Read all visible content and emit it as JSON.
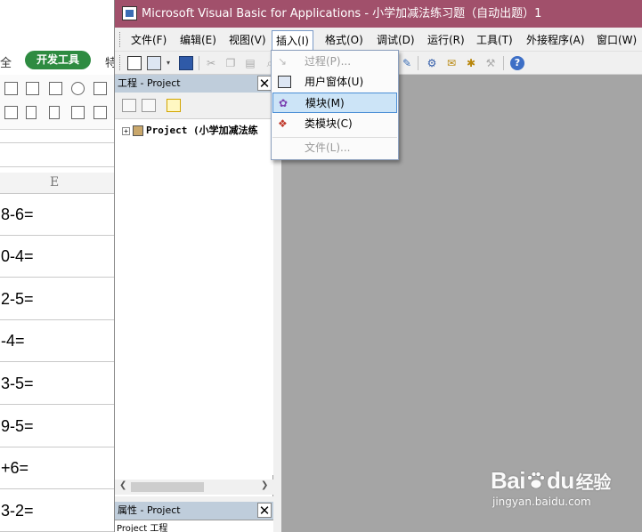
{
  "excel": {
    "ribbon": {
      "quan_label": "全",
      "dev_tools_tab": "开发工具",
      "te_label": "特"
    },
    "column_header": "E",
    "rows": [
      "8-6=",
      "0-4=",
      "2-5=",
      "-4=",
      "3-5=",
      "9-5=",
      "+6=",
      "3-2="
    ]
  },
  "vbe": {
    "title": "Microsoft Visual Basic for Applications - 小学加减法练习题（自动出题）1",
    "menu": [
      {
        "label": "文件(F)"
      },
      {
        "label": "编辑(E)"
      },
      {
        "label": "视图(V)"
      },
      {
        "label": "插入(I)",
        "open": true
      },
      {
        "label": "格式(O)"
      },
      {
        "label": "调试(D)"
      },
      {
        "label": "运行(R)"
      },
      {
        "label": "工具(T)"
      },
      {
        "label": "外接程序(A)"
      },
      {
        "label": "窗口(W)"
      }
    ],
    "insert_menu": {
      "items": [
        {
          "label": "过程(P)...",
          "enabled": false,
          "icon": "procedure-icon"
        },
        {
          "label": "用户窗体(U)",
          "enabled": true,
          "icon": "userform-icon"
        },
        {
          "label": "模块(M)",
          "enabled": true,
          "highlighted": true,
          "icon": "module-icon"
        },
        {
          "label": "类模块(C)",
          "enabled": true,
          "icon": "class-module-icon"
        },
        {
          "label": "文件(L)...",
          "enabled": false,
          "icon": ""
        }
      ]
    },
    "project_pane": {
      "header": "工程 - Project",
      "tree_root": "Project (小学加减法练"
    },
    "properties_pane": {
      "header": "属性 - Project",
      "body_text": "Project 工程"
    }
  },
  "watermark": {
    "brand": "Bai",
    "brand2": "du",
    "suffix": "经验",
    "url": "jingyan.baidu.com"
  },
  "colors": {
    "titlebar": "#a1506b",
    "pane_header": "#bfcddb",
    "code_bg": "#a5a5a5",
    "highlight": "#cce4f7",
    "dev_tab": "#2e8b41"
  }
}
